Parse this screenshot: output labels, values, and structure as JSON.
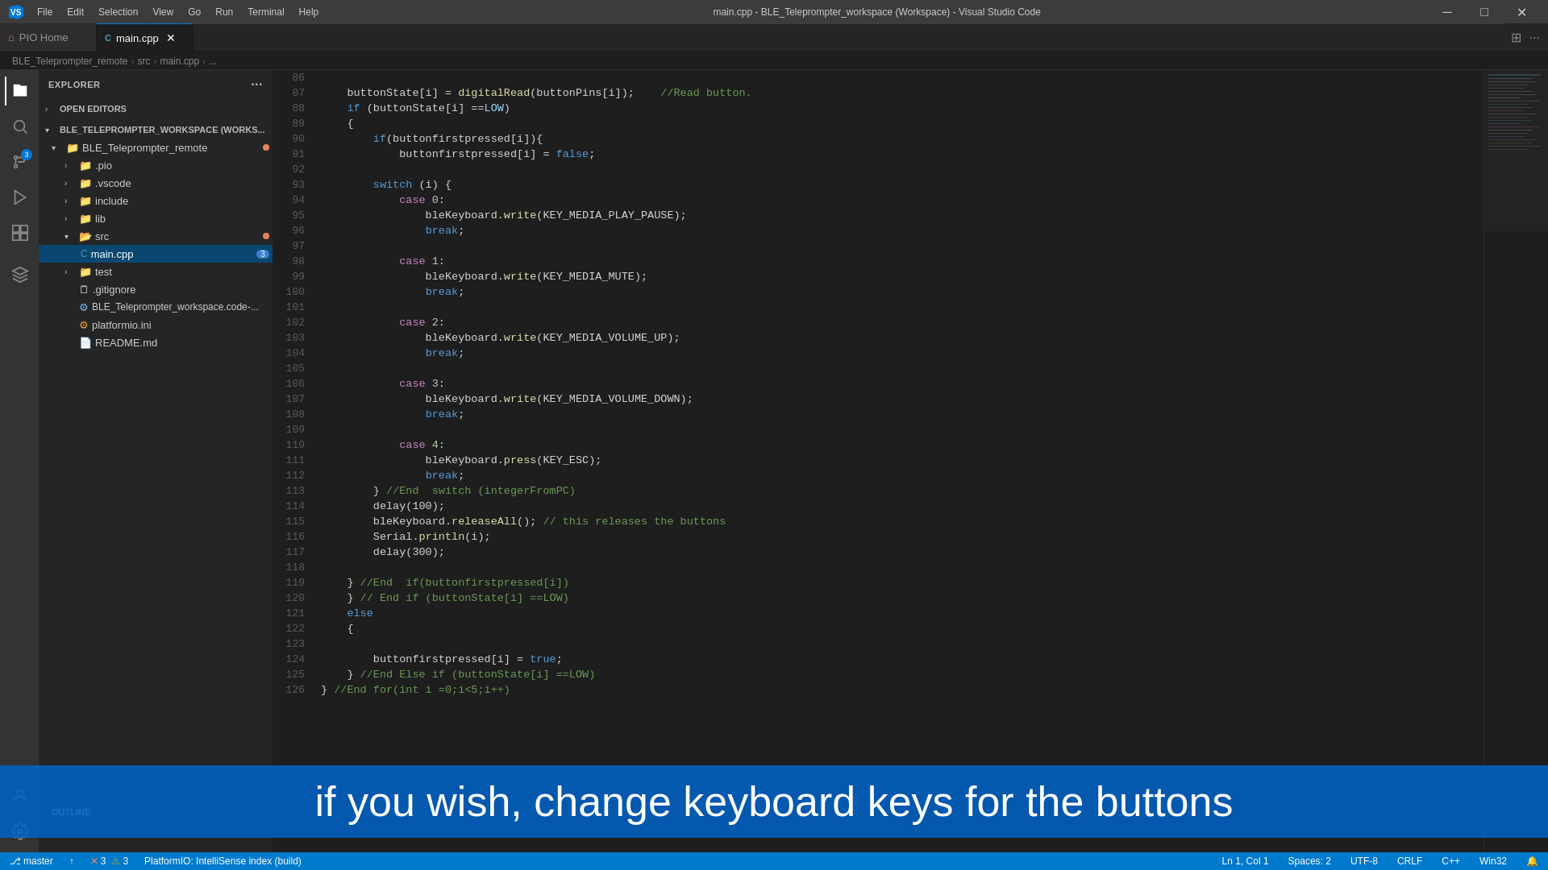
{
  "window": {
    "title": "main.cpp - BLE_Teleprompter_workspace (Workspace) - Visual Studio Code"
  },
  "titlebar": {
    "menus": [
      "File",
      "Edit",
      "Selection",
      "View",
      "Go",
      "Run",
      "Terminal",
      "Help"
    ],
    "logo": "VS"
  },
  "tabs": [
    {
      "id": "pio-home",
      "label": "PIO Home",
      "active": false,
      "icon": "🏠"
    },
    {
      "id": "main-cpp",
      "label": "main.cpp",
      "active": true,
      "icon": "C",
      "has_close": true,
      "modified": false
    }
  ],
  "breadcrumb": {
    "parts": [
      "BLE_Teleprompter_remote",
      "src",
      "main.cpp",
      "..."
    ]
  },
  "sidebar": {
    "title": "EXPLORER",
    "sections": {
      "open_editors": "OPEN EDITORS",
      "workspace": "BLE_TELEPROMPTER_WORKSPACE (WORKS..."
    },
    "tree": [
      {
        "id": "ble-remote",
        "label": "BLE_Teleprompter_remote",
        "depth": 1,
        "expanded": true,
        "type": "folder",
        "has_dot": true
      },
      {
        "id": "pio",
        "label": ".pio",
        "depth": 2,
        "expanded": false,
        "type": "folder"
      },
      {
        "id": "vscode",
        "label": ".vscode",
        "depth": 2,
        "expanded": false,
        "type": "folder"
      },
      {
        "id": "include",
        "label": "include",
        "depth": 2,
        "expanded": false,
        "type": "folder"
      },
      {
        "id": "lib",
        "label": "lib",
        "depth": 2,
        "expanded": false,
        "type": "folder"
      },
      {
        "id": "src",
        "label": "src",
        "depth": 2,
        "expanded": true,
        "type": "folder",
        "has_dot": true
      },
      {
        "id": "main-cpp-file",
        "label": "main.cpp",
        "depth": 3,
        "type": "file",
        "active": true,
        "badge": "3"
      },
      {
        "id": "test",
        "label": "test",
        "depth": 2,
        "expanded": false,
        "type": "folder"
      },
      {
        "id": "gitignore",
        "label": ".gitignore",
        "depth": 2,
        "type": "file"
      },
      {
        "id": "workspace-code",
        "label": "BLE_Teleprompter_workspace.code-...",
        "depth": 2,
        "type": "file"
      },
      {
        "id": "platformio-ini",
        "label": "platformio.ini",
        "depth": 2,
        "type": "file"
      },
      {
        "id": "readme",
        "label": "README.md",
        "depth": 2,
        "type": "file"
      }
    ]
  },
  "code": {
    "lines": [
      {
        "num": 86,
        "content": ""
      },
      {
        "num": 87,
        "tokens": [
          {
            "t": "    buttonState[i] = digitalRead(buttonPins[i]);    //Read button.",
            "c": "plain"
          }
        ]
      },
      {
        "num": 88,
        "tokens": [
          {
            "t": "    ",
            "c": "plain"
          },
          {
            "t": "if",
            "c": "kw"
          },
          {
            "t": " (buttonState[i] ==",
            "c": "plain"
          },
          {
            "t": "LOW",
            "c": "var"
          },
          {
            "t": ")",
            "c": "plain"
          }
        ]
      },
      {
        "num": 89,
        "tokens": [
          {
            "t": "    {",
            "c": "plain"
          }
        ]
      },
      {
        "num": 90,
        "tokens": [
          {
            "t": "        ",
            "c": "plain"
          },
          {
            "t": "if",
            "c": "kw"
          },
          {
            "t": "(buttonfirstpressed[i]){",
            "c": "plain"
          }
        ]
      },
      {
        "num": 91,
        "tokens": [
          {
            "t": "            buttonfirstpressed[i] = ",
            "c": "plain"
          },
          {
            "t": "false",
            "c": "bool"
          },
          {
            "t": ";",
            "c": "plain"
          }
        ]
      },
      {
        "num": 92,
        "content": ""
      },
      {
        "num": 93,
        "tokens": [
          {
            "t": "        ",
            "c": "plain"
          },
          {
            "t": "switch",
            "c": "kw"
          },
          {
            "t": " (i) {",
            "c": "plain"
          }
        ]
      },
      {
        "num": 94,
        "tokens": [
          {
            "t": "            ",
            "c": "plain"
          },
          {
            "t": "case",
            "c": "kw2"
          },
          {
            "t": " 0:",
            "c": "num"
          }
        ]
      },
      {
        "num": 95,
        "tokens": [
          {
            "t": "                bleKeyboard.",
            "c": "plain"
          },
          {
            "t": "write",
            "c": "fn"
          },
          {
            "t": "(KEY_MEDIA_PLAY_PAUSE);",
            "c": "plain"
          }
        ]
      },
      {
        "num": 96,
        "tokens": [
          {
            "t": "                ",
            "c": "plain"
          },
          {
            "t": "break",
            "c": "kw"
          },
          {
            "t": ";",
            "c": "plain"
          }
        ]
      },
      {
        "num": 97,
        "content": ""
      },
      {
        "num": 98,
        "tokens": [
          {
            "t": "            ",
            "c": "plain"
          },
          {
            "t": "case",
            "c": "kw2"
          },
          {
            "t": " 1:",
            "c": "num"
          }
        ]
      },
      {
        "num": 99,
        "tokens": [
          {
            "t": "                bleKeyboard.",
            "c": "plain"
          },
          {
            "t": "write",
            "c": "fn"
          },
          {
            "t": "(KEY_MEDIA_MUTE);",
            "c": "plain"
          }
        ]
      },
      {
        "num": 100,
        "tokens": [
          {
            "t": "                ",
            "c": "plain"
          },
          {
            "t": "break",
            "c": "kw"
          },
          {
            "t": ";",
            "c": "plain"
          }
        ]
      },
      {
        "num": 101,
        "content": ""
      },
      {
        "num": 102,
        "tokens": [
          {
            "t": "            ",
            "c": "plain"
          },
          {
            "t": "case",
            "c": "kw2"
          },
          {
            "t": " 2:",
            "c": "num"
          }
        ]
      },
      {
        "num": 103,
        "tokens": [
          {
            "t": "                bleKeyboard.",
            "c": "plain"
          },
          {
            "t": "write",
            "c": "fn"
          },
          {
            "t": "(KEY_MEDIA_VOLUME_UP);",
            "c": "plain"
          }
        ]
      },
      {
        "num": 104,
        "tokens": [
          {
            "t": "                ",
            "c": "plain"
          },
          {
            "t": "break",
            "c": "kw"
          },
          {
            "t": ";",
            "c": "plain"
          }
        ]
      },
      {
        "num": 105,
        "content": ""
      },
      {
        "num": 106,
        "tokens": [
          {
            "t": "            ",
            "c": "plain"
          },
          {
            "t": "case",
            "c": "kw2"
          },
          {
            "t": " 3:",
            "c": "num"
          }
        ]
      },
      {
        "num": 107,
        "tokens": [
          {
            "t": "                bleKeyboard.",
            "c": "plain"
          },
          {
            "t": "write",
            "c": "fn"
          },
          {
            "t": "(KEY_MEDIA_VOLUME_DOWN);",
            "c": "plain"
          }
        ]
      },
      {
        "num": 108,
        "tokens": [
          {
            "t": "                ",
            "c": "plain"
          },
          {
            "t": "break",
            "c": "kw"
          },
          {
            "t": ";",
            "c": "plain"
          }
        ]
      },
      {
        "num": 109,
        "content": ""
      },
      {
        "num": 110,
        "tokens": [
          {
            "t": "            ",
            "c": "plain"
          },
          {
            "t": "case",
            "c": "kw2"
          },
          {
            "t": " 4:",
            "c": "num"
          }
        ]
      },
      {
        "num": 111,
        "tokens": [
          {
            "t": "                bleKeyboard.",
            "c": "plain"
          },
          {
            "t": "press",
            "c": "fn"
          },
          {
            "t": "(KEY_ESC);",
            "c": "plain"
          }
        ]
      },
      {
        "num": 112,
        "tokens": [
          {
            "t": "                ",
            "c": "plain"
          },
          {
            "t": "break",
            "c": "kw"
          },
          {
            "t": ";",
            "c": "plain"
          }
        ]
      },
      {
        "num": 113,
        "tokens": [
          {
            "t": "        } ",
            "c": "plain"
          },
          {
            "t": "//End  switch (integerFromPC)",
            "c": "comment"
          }
        ]
      },
      {
        "num": 114,
        "tokens": [
          {
            "t": "        delay(100);",
            "c": "plain"
          }
        ]
      },
      {
        "num": 115,
        "tokens": [
          {
            "t": "        bleKeyboard.",
            "c": "plain"
          },
          {
            "t": "releaseAll",
            "c": "fn"
          },
          {
            "t": "(); ",
            "c": "plain"
          },
          {
            "t": "// this releases the buttons",
            "c": "comment"
          }
        ]
      },
      {
        "num": 116,
        "tokens": [
          {
            "t": "        Serial.",
            "c": "plain"
          },
          {
            "t": "println",
            "c": "fn"
          },
          {
            "t": "(i);",
            "c": "plain"
          }
        ]
      },
      {
        "num": 117,
        "tokens": [
          {
            "t": "        delay(300);",
            "c": "plain"
          }
        ]
      },
      {
        "num": 118,
        "content": ""
      },
      {
        "num": 119,
        "tokens": [
          {
            "t": "    } ",
            "c": "plain"
          },
          {
            "t": "//End  if(buttonfirstpressed[i])",
            "c": "comment"
          }
        ]
      },
      {
        "num": 120,
        "tokens": [
          {
            "t": "    } ",
            "c": "plain"
          },
          {
            "t": "// End if (buttonState[i] ==LOW)",
            "c": "comment"
          }
        ]
      },
      {
        "num": 121,
        "tokens": [
          {
            "t": "    ",
            "c": "plain"
          },
          {
            "t": "else",
            "c": "kw"
          }
        ]
      },
      {
        "num": 122,
        "tokens": [
          {
            "t": "    {",
            "c": "plain"
          }
        ]
      },
      {
        "num": 123,
        "content": ""
      },
      {
        "num": 124,
        "tokens": [
          {
            "t": "        buttonfirstpressed[i] = ",
            "c": "plain"
          },
          {
            "t": "true",
            "c": "bool"
          },
          {
            "t": ";",
            "c": "plain"
          }
        ]
      },
      {
        "num": 125,
        "tokens": [
          {
            "t": "    } ",
            "c": "plain"
          },
          {
            "t": "//End Else if (buttonState[i] ==LOW)",
            "c": "comment"
          }
        ]
      },
      {
        "num": 126,
        "tokens": [
          {
            "t": "} ",
            "c": "plain"
          },
          {
            "t": "//End for(int i =0;i<5;i++)",
            "c": "comment"
          }
        ]
      }
    ]
  },
  "caption": {
    "text": "if you wish, change keyboard keys for the buttons"
  },
  "status": {
    "branch": "master",
    "sync_icon": "↑",
    "errors": "3",
    "warnings": "3",
    "info_icon": "ⓘ",
    "platformio": "PlatformIO: IntelliSense index (build)",
    "position": "Ln 1, Col 1",
    "spaces": "Spaces: 2",
    "encoding": "UTF-8",
    "line_ending": "CRLF",
    "language": "C++",
    "os": "Win32"
  },
  "outline": {
    "label": "OUTLINE"
  }
}
